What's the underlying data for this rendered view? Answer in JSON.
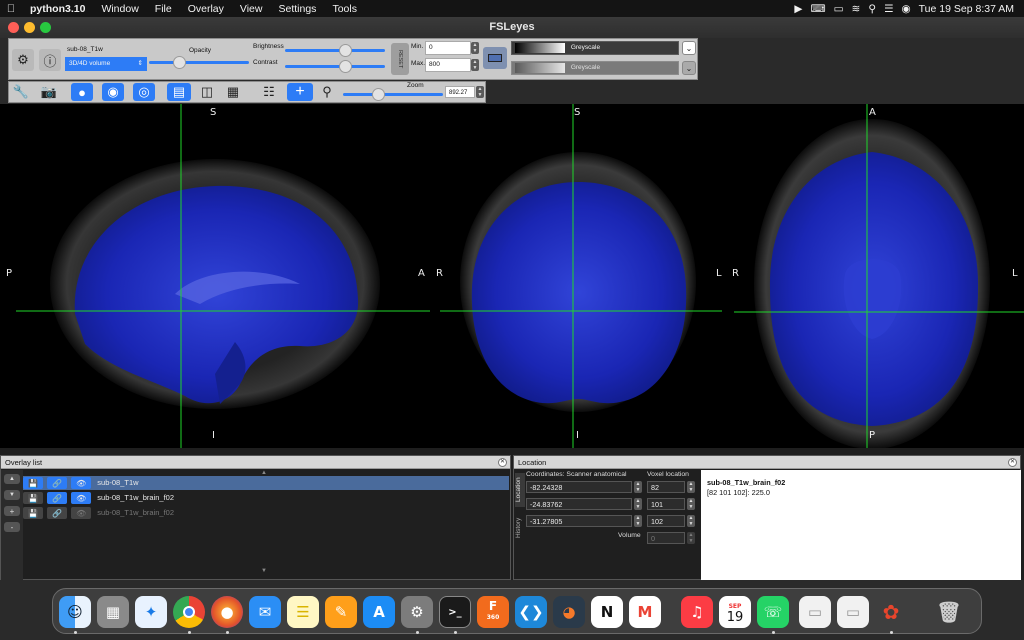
{
  "menubar": {
    "app_name": "python3.10",
    "items": [
      "Window",
      "File",
      "Overlay",
      "View",
      "Settings",
      "Tools"
    ],
    "datetime": "Tue 19 Sep  8:37 AM"
  },
  "window": {
    "title": "FSLeyes"
  },
  "overlay_toolbar": {
    "overlay_name": "sub-08_T1w",
    "volume_type": "3D/4D volume",
    "opacity_label": "Opacity",
    "opacity": 0.3,
    "brightness_label": "Brightness",
    "brightness": 0.6,
    "contrast_label": "Contrast",
    "contrast": 0.6,
    "reset_label": "RESET",
    "min_label": "Min.",
    "min_value": "0",
    "max_label": "Max.",
    "max_value": "800",
    "colormap": "Greyscale",
    "colormap2": "Greyscale"
  },
  "view_toolbar": {
    "zoom_label": "Zoom",
    "zoom_value": "892.27",
    "zoom_fraction": 0.35
  },
  "viewer": {
    "sagittal": {
      "top": "S",
      "bottom": "I",
      "left": "P",
      "right": "A"
    },
    "coronal": {
      "top": "S",
      "bottom": "I",
      "left": "R",
      "right": "L"
    },
    "axial": {
      "top": "A",
      "bottom": "P",
      "left": "R",
      "right": "L"
    }
  },
  "overlay_list": {
    "title": "Overlay list",
    "items": [
      {
        "name": "sub-08_T1w",
        "selected": true
      },
      {
        "name": "sub-08_T1w_brain_f02",
        "selected": false
      },
      {
        "name": "sub-08_T1w_brain_f02",
        "selected": false,
        "disabled": true
      }
    ]
  },
  "location": {
    "title": "Location",
    "tab_location": "Location",
    "tab_history": "History",
    "coords_header": "Coordinates: Scanner anatomical",
    "voxel_header": "Voxel location",
    "coords": [
      "-82.24328",
      "-24.83762",
      "-31.27805"
    ],
    "voxels": [
      "82",
      "101",
      "102"
    ],
    "volume_label": "Volume",
    "volume_value": "0",
    "info_name": "sub-08_T1w_brain_f02",
    "info_value": "[82 101 102]: 225.0"
  },
  "dock": {
    "items": [
      "finder",
      "launchpad",
      "safari",
      "chrome",
      "firefox",
      "mail",
      "notes",
      "pages",
      "app-store",
      "system-settings",
      "terminal",
      "fusion-360",
      "vscode",
      "blender",
      "notion",
      "gmail",
      "music",
      "calendar",
      "whatsapp",
      "document",
      "document",
      "fsleyes",
      "trash"
    ],
    "calendar_month": "SEP",
    "calendar_day": "19",
    "fusion_label": "360"
  }
}
